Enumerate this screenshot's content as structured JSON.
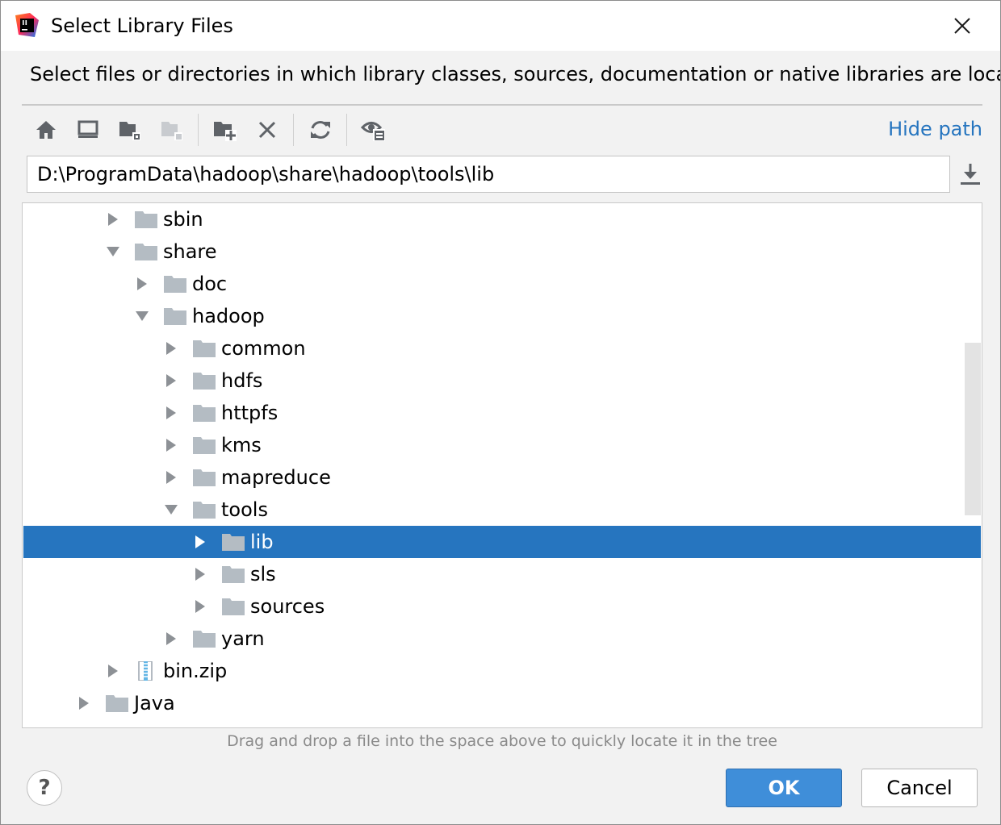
{
  "window": {
    "title": "Select Library Files",
    "app_icon": "intellij-idea-icon",
    "close_icon": "close-icon"
  },
  "description": "Select files or directories in which library classes, sources, documentation or native libraries are located",
  "toolbar": {
    "buttons": [
      {
        "icon": "home-icon",
        "enabled": true
      },
      {
        "icon": "desktop-icon",
        "enabled": true
      },
      {
        "icon": "project-folder-icon",
        "enabled": true
      },
      {
        "icon": "module-folder-icon",
        "enabled": false
      },
      {
        "icon": "new-folder-icon",
        "enabled": true
      },
      {
        "icon": "delete-icon",
        "enabled": true
      },
      {
        "icon": "refresh-icon",
        "enabled": true
      },
      {
        "icon": "show-hidden-files-icon",
        "enabled": true
      }
    ],
    "hide_path_label": "Hide path"
  },
  "path": {
    "value": "D:\\ProgramData\\hadoop\\share\\hadoop\\tools\\lib",
    "go_icon": "download-icon"
  },
  "tree": {
    "items": [
      {
        "label": "sbin",
        "level": 3,
        "expanded": false,
        "type": "folder",
        "selected": false
      },
      {
        "label": "share",
        "level": 3,
        "expanded": true,
        "type": "folder",
        "selected": false
      },
      {
        "label": "doc",
        "level": 4,
        "expanded": false,
        "type": "folder",
        "selected": false
      },
      {
        "label": "hadoop",
        "level": 4,
        "expanded": true,
        "type": "folder",
        "selected": false
      },
      {
        "label": "common",
        "level": 5,
        "expanded": false,
        "type": "folder",
        "selected": false
      },
      {
        "label": "hdfs",
        "level": 5,
        "expanded": false,
        "type": "folder",
        "selected": false
      },
      {
        "label": "httpfs",
        "level": 5,
        "expanded": false,
        "type": "folder",
        "selected": false
      },
      {
        "label": "kms",
        "level": 5,
        "expanded": false,
        "type": "folder",
        "selected": false
      },
      {
        "label": "mapreduce",
        "level": 5,
        "expanded": false,
        "type": "folder",
        "selected": false
      },
      {
        "label": "tools",
        "level": 5,
        "expanded": true,
        "type": "folder",
        "selected": false
      },
      {
        "label": "lib",
        "level": 6,
        "expanded": false,
        "type": "folder",
        "selected": true
      },
      {
        "label": "sls",
        "level": 6,
        "expanded": false,
        "type": "folder",
        "selected": false
      },
      {
        "label": "sources",
        "level": 6,
        "expanded": false,
        "type": "folder",
        "selected": false
      },
      {
        "label": "yarn",
        "level": 5,
        "expanded": false,
        "type": "folder",
        "selected": false
      },
      {
        "label": "bin.zip",
        "level": 3,
        "expanded": false,
        "type": "zip",
        "selected": false
      },
      {
        "label": "Java",
        "level": 2,
        "expanded": false,
        "type": "folder",
        "selected": false
      }
    ]
  },
  "hint": "Drag and drop a file into the space above to quickly locate it in the tree",
  "buttons": {
    "help_label": "?",
    "ok_label": "OK",
    "cancel_label": "Cancel"
  },
  "colors": {
    "selection": "#2675bf",
    "link": "#2675bf",
    "folder": "#b4bcc3",
    "ok_button": "#3f8ed9"
  }
}
